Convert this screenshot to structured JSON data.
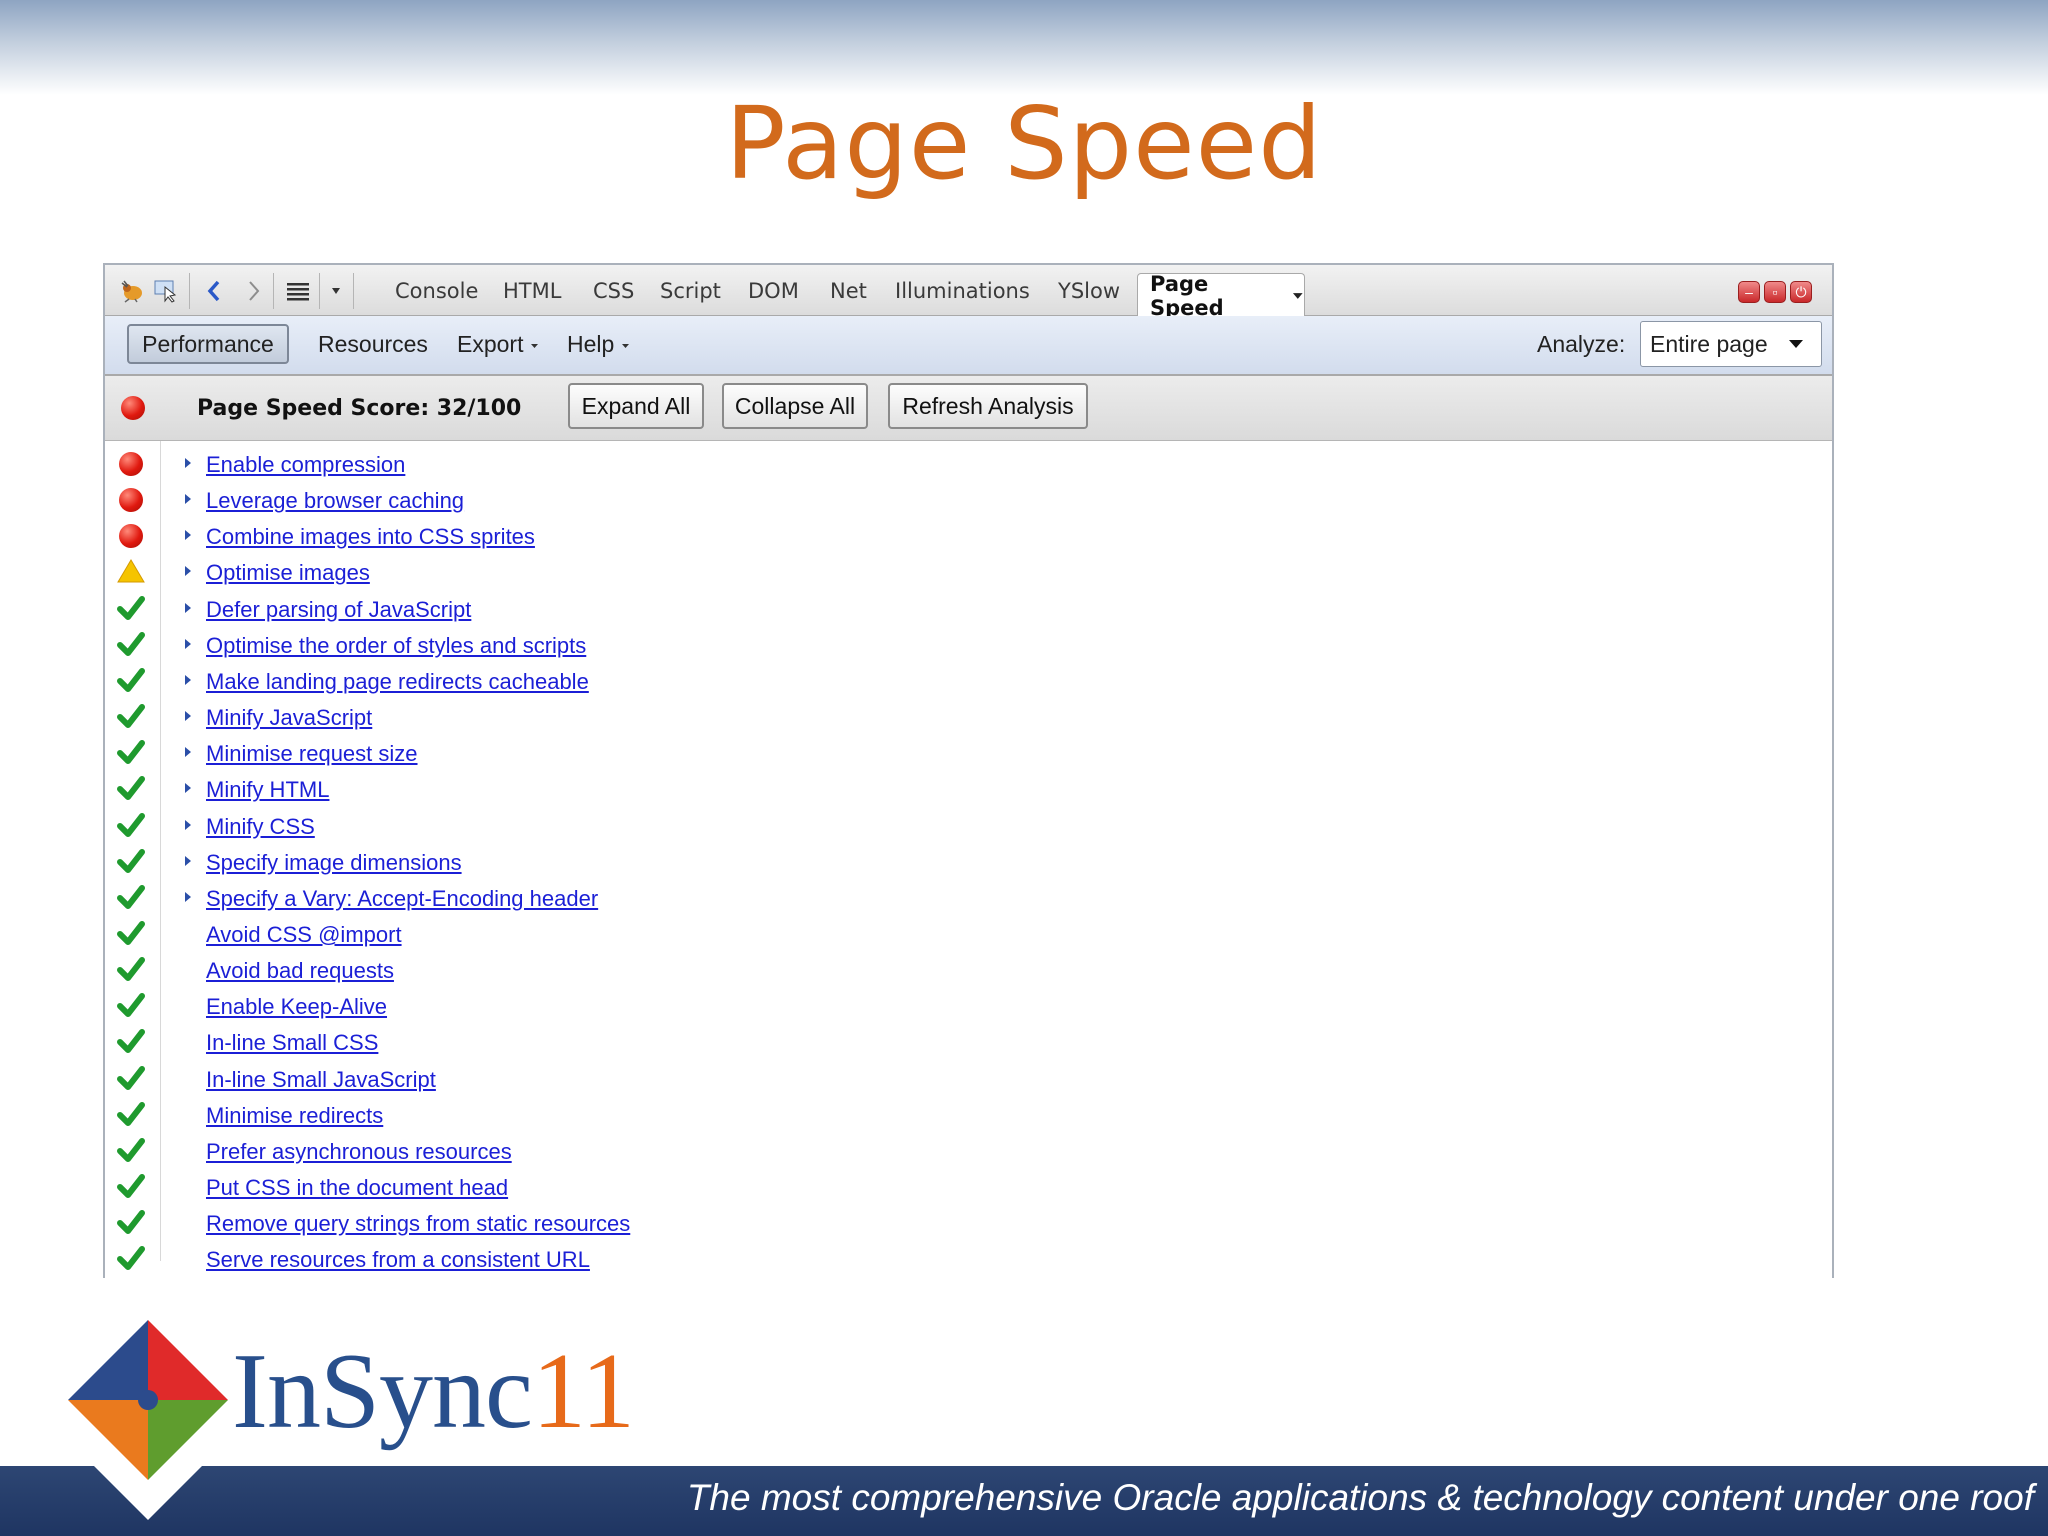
{
  "slide": {
    "title": "Page Speed",
    "tagline": "The most comprehensive Oracle applications & technology content under one roof"
  },
  "logo": {
    "text_main": "InSync",
    "text_num": "11"
  },
  "firebug": {
    "tabs": [
      "Console",
      "HTML",
      "CSS",
      "Script",
      "DOM",
      "Net",
      "Illuminations",
      "YSlow"
    ],
    "active_tab": "Page Speed",
    "menu": {
      "performance": "Performance",
      "resources": "Resources",
      "export": "Export",
      "help": "Help",
      "analyze_label": "Analyze:",
      "analyze_value": "Entire page"
    },
    "score": {
      "label": "Page Speed Score: 32/100",
      "expand_all": "Expand All",
      "collapse_all": "Collapse All",
      "refresh": "Refresh Analysis"
    },
    "rules": [
      {
        "label": "Enable compression",
        "status": "fail",
        "expandable": true
      },
      {
        "label": "Leverage browser caching",
        "status": "fail",
        "expandable": true
      },
      {
        "label": "Combine images into CSS sprites",
        "status": "fail",
        "expandable": true
      },
      {
        "label": "Optimise images",
        "status": "warn",
        "expandable": true
      },
      {
        "label": "Defer parsing of JavaScript",
        "status": "pass",
        "expandable": true
      },
      {
        "label": "Optimise the order of styles and scripts",
        "status": "pass",
        "expandable": true
      },
      {
        "label": "Make landing page redirects cacheable",
        "status": "pass",
        "expandable": true
      },
      {
        "label": "Minify JavaScript",
        "status": "pass",
        "expandable": true
      },
      {
        "label": "Minimise request size",
        "status": "pass",
        "expandable": true
      },
      {
        "label": "Minify HTML",
        "status": "pass",
        "expandable": true
      },
      {
        "label": "Minify CSS",
        "status": "pass",
        "expandable": true
      },
      {
        "label": "Specify image dimensions",
        "status": "pass",
        "expandable": true
      },
      {
        "label": "Specify a Vary: Accept-Encoding header",
        "status": "pass",
        "expandable": true
      },
      {
        "label": "Avoid CSS @import",
        "status": "pass",
        "expandable": false
      },
      {
        "label": "Avoid bad requests",
        "status": "pass",
        "expandable": false
      },
      {
        "label": "Enable Keep-Alive",
        "status": "pass",
        "expandable": false
      },
      {
        "label": "In-line Small CSS",
        "status": "pass",
        "expandable": false
      },
      {
        "label": "In-line Small JavaScript",
        "status": "pass",
        "expandable": false
      },
      {
        "label": "Minimise redirects",
        "status": "pass",
        "expandable": false
      },
      {
        "label": "Prefer asynchronous resources",
        "status": "pass",
        "expandable": false
      },
      {
        "label": "Put CSS in the document head",
        "status": "pass",
        "expandable": false
      },
      {
        "label": "Remove query strings from static resources",
        "status": "pass",
        "expandable": false
      },
      {
        "label": "Serve resources from a consistent URL",
        "status": "pass",
        "expandable": false
      }
    ]
  },
  "colors": {
    "title": "#d26a1c",
    "link": "#1b1fd6",
    "fail": "#e0190f",
    "warn": "#f5c400",
    "pass": "#1f9a2e",
    "footer": "#1f3562"
  }
}
